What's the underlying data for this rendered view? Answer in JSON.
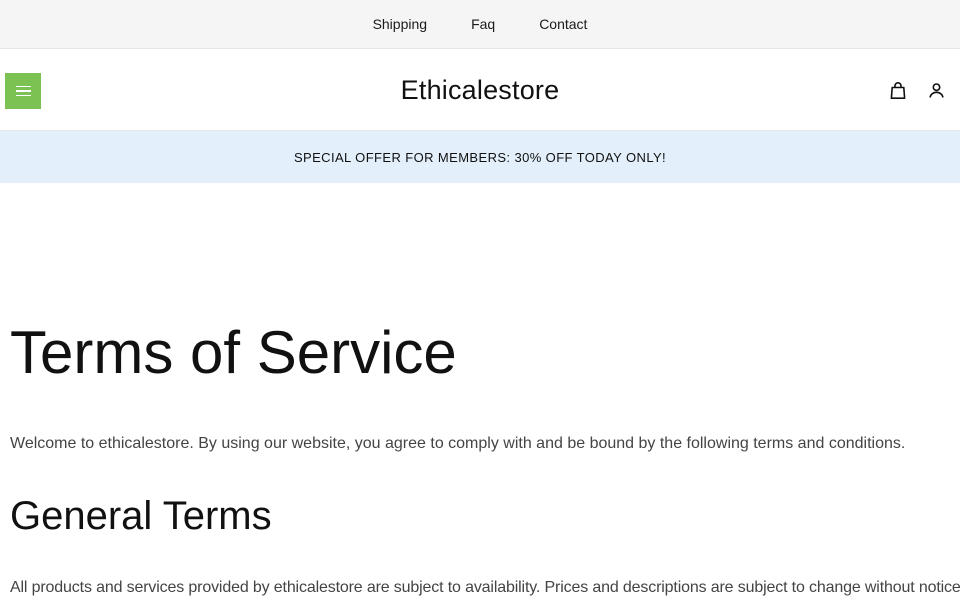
{
  "top_nav": {
    "items": [
      {
        "label": "Shipping"
      },
      {
        "label": "Faq"
      },
      {
        "label": "Contact"
      }
    ]
  },
  "header": {
    "logo": "Ethicalestore",
    "menu_icon": "hamburger-icon",
    "cart_icon": "shopping-bag-icon",
    "account_icon": "user-icon",
    "menu_button_color": "#7cc253"
  },
  "promo": {
    "text": "SPECIAL OFFER FOR MEMBERS: 30% OFF TODAY ONLY!",
    "background": "#e3f0fb"
  },
  "main": {
    "title": "Terms of Service",
    "intro": "Welcome to ethicalestore. By using our website, you agree to comply with and be bound by the following terms and conditions.",
    "sections": [
      {
        "heading": "General Terms",
        "text": "All products and services provided by ethicalestore are subject to availability. Prices and descriptions are subject to change without notice."
      }
    ]
  }
}
